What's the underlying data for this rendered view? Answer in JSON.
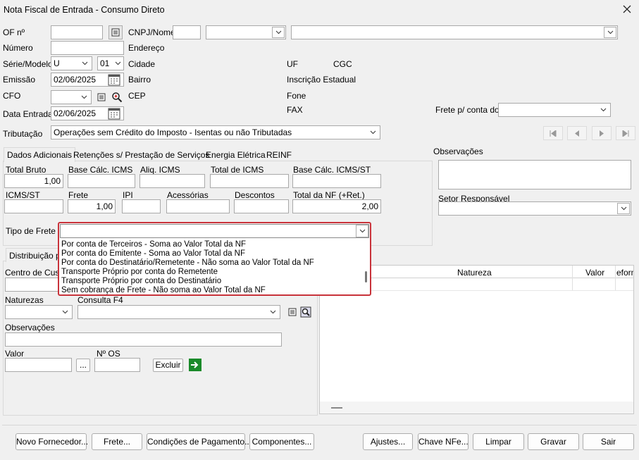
{
  "window": {
    "title": "Nota Fiscal de Entrada - Consumo Direto"
  },
  "header": {
    "of_label": "OF nº",
    "cnpj_label": "CNPJ/Nome",
    "numero_label": "Número",
    "endereco_label": "Endereço",
    "serie_label": "Série/Modelo",
    "serie_value": "U",
    "modelo_value": "01",
    "cidade_label": "Cidade",
    "uf_label": "UF",
    "cgc_label": "CGC",
    "emissao_label": "Emissão",
    "emissao_value": "02/06/2025",
    "bairro_label": "Bairro",
    "inscricao_label": "Inscrição Estadual",
    "cfo_label": "CFO",
    "cep_label": "CEP",
    "fone_label": "Fone",
    "fax_label": "FAX",
    "data_entrada_label": "Data Entrada",
    "data_entrada_value": "02/06/2025",
    "frete_conta_label": "Frete p/ conta do",
    "tributacao_label": "Tributação",
    "tributacao_value": "Operações sem Crédito do Imposto - Isentas ou não Tributadas"
  },
  "tabs": [
    "Dados Adicionais",
    "Retenções s/ Prestação de Serviços",
    "Energia Elétrica",
    "REINF"
  ],
  "totals": {
    "total_bruto_label": "Total Bruto",
    "total_bruto_value": "1,00",
    "base_icms_label": "Base Cálc. ICMS",
    "aliq_icms_label": "Aliq. ICMS",
    "total_icms_label": "Total de ICMS",
    "base_icms_st_label": "Base Cálc. ICMS/ST",
    "icms_st_label": "ICMS/ST",
    "frete_label": "Frete",
    "frete_value": "1,00",
    "ipi_label": "IPI",
    "acessorias_label": "Acessórias",
    "descontos_label": "Descontos",
    "total_nf_label": "Total da NF (+Ret.)",
    "total_nf_value": "2,00"
  },
  "tipo_frete": {
    "label": "Tipo de Frete",
    "value": "",
    "options": [
      "Por conta de Terceiros - Soma ao Valor Total da NF",
      "Por conta do Emitente - Soma ao Valor Total da NF",
      "Por conta do Destinatário/Remetente - Não soma ao Valor Total da NF",
      "Transporte Próprio por conta do Remetente",
      "Transporte Próprio por conta do Destinatário",
      "Sem cobrança de Frete - Não soma ao Valor Total da NF"
    ]
  },
  "right": {
    "observacoes_label": "Observações",
    "setor_label": "Setor Responsável"
  },
  "distribuicao": {
    "tab_label": "Distribuição po",
    "centro_label": "Centro de Custo",
    "naturezas_label": "Naturezas",
    "consulta_label": "Consulta F4",
    "obs_label": "Observações",
    "valor_label": "Valor",
    "nos_label": "Nº OS",
    "ellipsis": "...",
    "excluir_label": "Excluir"
  },
  "grid": {
    "columns": [
      "Natureza",
      "Valor",
      "eform"
    ]
  },
  "footer": {
    "buttons": [
      "Novo Fornecedor...",
      "Frete...",
      "Condições de Pagamento...",
      "Componentes...",
      "Ajustes...",
      "Chave NFe...",
      "Limpar",
      "Gravar",
      "Sair"
    ]
  },
  "icons": {
    "close": "close-icon",
    "list": "list-icon",
    "zoom": "magnifier-icon",
    "calendar": "calendar-icon",
    "arrow": "green-arrow-icon"
  }
}
